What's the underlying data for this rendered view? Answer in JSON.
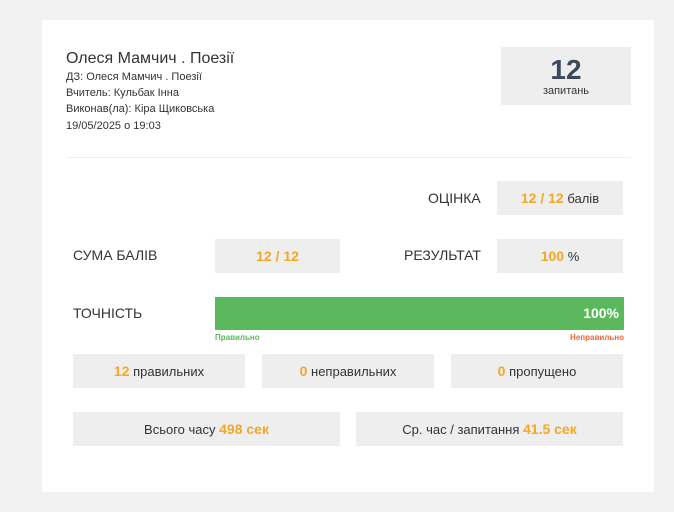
{
  "header": {
    "title": "Олеся Мамчич . Поезії",
    "assignment": "ДЗ: Олеся Мамчич . Поезії",
    "teacher": "Вчитель: Кульбак Інна",
    "performer": "Виконав(ла): Кіра Щиковська",
    "date": "19/05/2025 о 19:03"
  },
  "questions": {
    "count": "12",
    "label": "запитань"
  },
  "grade": {
    "label": "ОЦІНКА",
    "value": "12 / 12",
    "unit": "балів"
  },
  "score": {
    "label": "СУМА БАЛІВ",
    "value": "12 / 12"
  },
  "result": {
    "label": "РЕЗУЛЬТАТ",
    "value": "100",
    "unit": "%"
  },
  "accuracy": {
    "label": "ТОЧНІСТЬ",
    "percent": 100,
    "percent_text": "100%",
    "correct_label": "Правильно",
    "incorrect_label": "Неправильно"
  },
  "stats": {
    "correct": {
      "value": "12",
      "label": "правильних"
    },
    "incorrect": {
      "value": "0",
      "label": "неправильних"
    },
    "skipped": {
      "value": "0",
      "label": "пропущено"
    }
  },
  "time": {
    "total_label": "Всього часу",
    "total_value": "498 сек",
    "avg_label": "Ср. час / запитання",
    "avg_value": "41.5 сек"
  },
  "colors": {
    "accent": "#f5a623",
    "bar": "#5cb85c",
    "correct": "#5cb85c",
    "incorrect": "#f0643c"
  }
}
